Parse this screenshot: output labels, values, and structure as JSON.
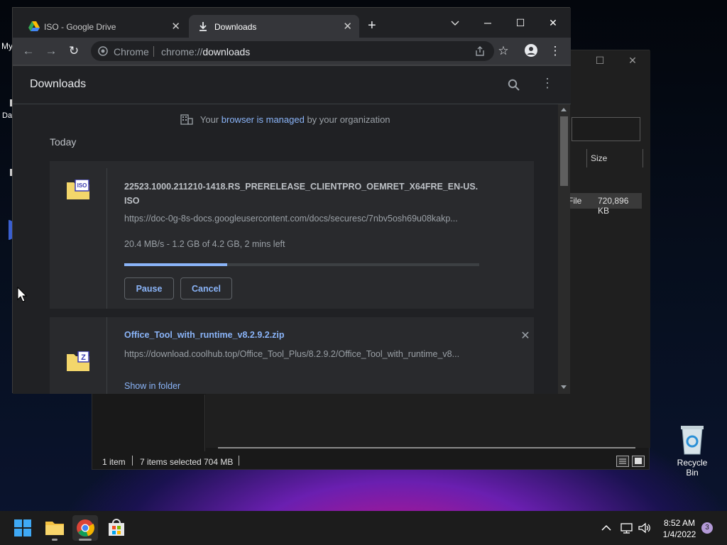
{
  "desktop": {
    "fragments": [
      "My",
      "Da"
    ],
    "recycle_bin_label": "Recycle Bin"
  },
  "explorer": {
    "column_size_label": "Size",
    "row_type": "File",
    "row_size": "720,896 KB",
    "status_items": "1 item",
    "status_selected": "7 items selected",
    "status_size": "704 MB"
  },
  "chrome": {
    "tabs": [
      {
        "title": "ISO - Google Drive",
        "active": false
      },
      {
        "title": "Downloads",
        "active": true
      }
    ],
    "new_tab": "+",
    "omnibox": {
      "site_label": "Chrome",
      "scheme": "chrome://",
      "path": "downloads"
    },
    "downloads_page": {
      "title": "Downloads",
      "managed_prefix": "Your",
      "managed_link": "browser is managed",
      "managed_suffix": "by your organization",
      "section_label": "Today",
      "items": [
        {
          "icon_label": "ISO",
          "filename": "22523.1000.211210-1418.RS_PRERELEASE_CLIENTPRO_OEMRET_X64FRE_EN-US.ISO",
          "url": "https://doc-0g-8s-docs.googleusercontent.com/docs/securesc/7nbv5osh69u08kakp...",
          "status": "20.4 MB/s - 1.2 GB of 4.2 GB, 2 mins left",
          "progress_fraction": 0.29,
          "pause_label": "Pause",
          "cancel_label": "Cancel"
        },
        {
          "icon_label": "Z",
          "filename": "Office_Tool_with_runtime_v8.2.9.2.zip",
          "url": "https://download.coolhub.top/Office_Tool_Plus/8.2.9.2/Office_Tool_with_runtime_v8...",
          "show_in_folder_label": "Show in folder"
        }
      ]
    }
  },
  "taskbar": {
    "time": "8:52 AM",
    "date": "1/4/2022",
    "notification_count": "3"
  },
  "colors": {
    "accent": "#8ab4f8",
    "chrome_bg": "#202124",
    "toolbar": "#35363a"
  }
}
